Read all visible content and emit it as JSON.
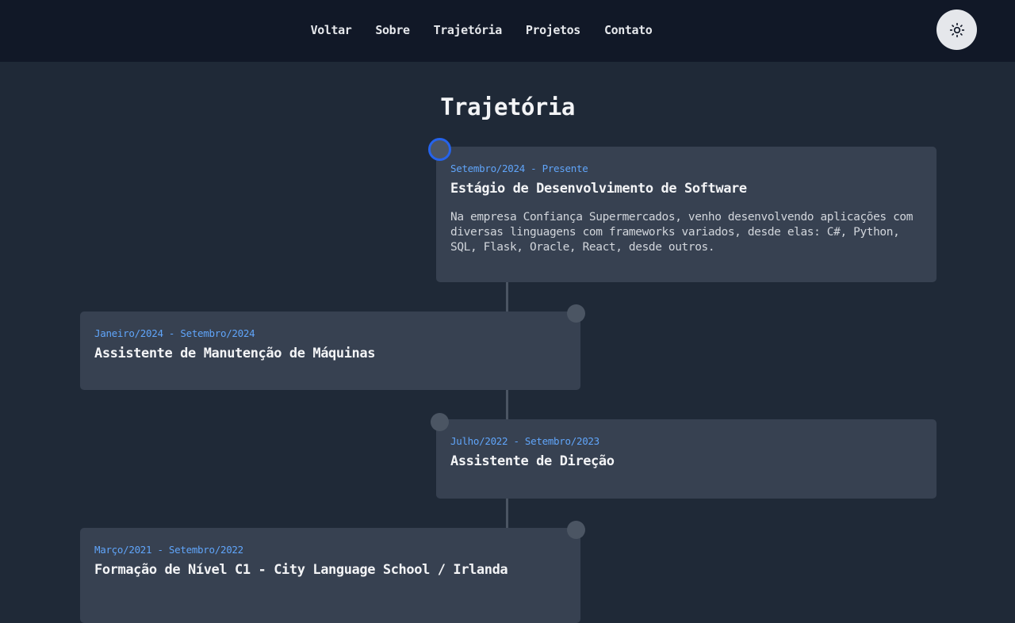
{
  "nav": {
    "items": [
      {
        "label": "Voltar"
      },
      {
        "label": "Sobre"
      },
      {
        "label": "Trajetória"
      },
      {
        "label": "Projetos"
      },
      {
        "label": "Contato"
      }
    ],
    "theme_toggle_icon": "sun-icon"
  },
  "page": {
    "title": "Trajetória"
  },
  "timeline": [
    {
      "date": "Setembro/2024 - Presente",
      "title": "Estágio de Desenvolvimento de Software",
      "description": "Na empresa Confiança Supermercados, venho desenvolvendo aplicações com diversas linguagens com frameworks variados, desde elas: C#, Python, SQL, Flask, Oracle, React, desde outros."
    },
    {
      "date": "Janeiro/2024 - Setembro/2024",
      "title": "Assistente de Manutenção de Máquinas"
    },
    {
      "date": "Julho/2022 - Setembro/2023",
      "title": "Assistente de Direção"
    },
    {
      "date": "Março/2021 - Setembro/2022",
      "title": "Formação de Nível C1 - City Language School / Irlanda"
    }
  ],
  "colors": {
    "background": "#1f2937",
    "navbar": "#111827",
    "card": "#374151",
    "accent": "#60a5fa",
    "active_dot_ring": "#2563eb"
  }
}
